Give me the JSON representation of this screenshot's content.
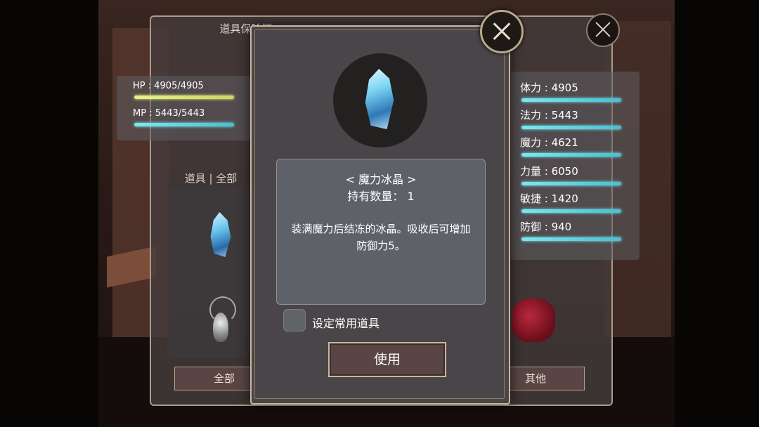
{
  "back_panel": {
    "title": "道具保险箱",
    "filter_left": "全部",
    "filter_right": "其他",
    "inventory_tab": "道具 | 全部"
  },
  "status": {
    "hp": "HP : 4905/4905",
    "hp_fill": 1.0,
    "mp": "MP : 5443/5443",
    "mp_fill": 1.0
  },
  "stats": [
    {
      "label": "体力 : 4905"
    },
    {
      "label": "法力 : 5443"
    },
    {
      "label": "魔力 : 4621"
    },
    {
      "label": "力量 : 6050"
    },
    {
      "label": "敏捷 : 1420"
    },
    {
      "label": "防御 : 940"
    }
  ],
  "item_modal": {
    "name": "< 魔力冰晶 >",
    "quantity": "持有数量： 1",
    "description": "装满魔力后结冻的冰晶。吸收后可增加防御力5。",
    "favorite_label": "设定常用道具",
    "favorite_checked": false,
    "use_label": "使用"
  },
  "colors": {
    "hp_bar": "#e0ea7a",
    "mp_bar": "#6ee0ec",
    "panel_border": "#c8b89c"
  }
}
